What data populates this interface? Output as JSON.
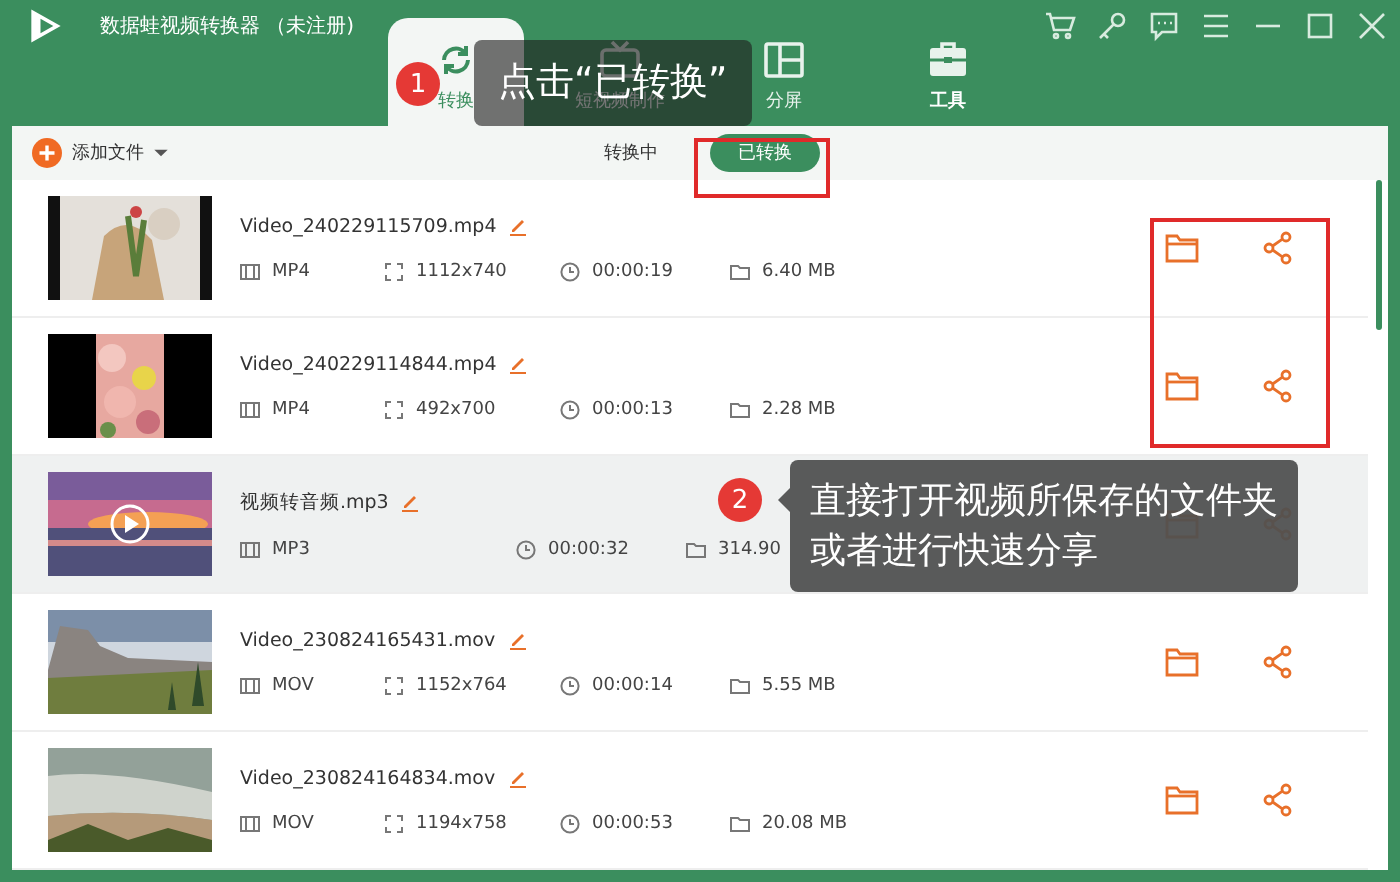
{
  "window": {
    "title": "数据蛙视频转换器 （未注册)"
  },
  "tabs": [
    {
      "label": "转换",
      "selected": true
    },
    {
      "label": "短视频制作",
      "selected": false
    },
    {
      "label": "分屏",
      "selected": false
    },
    {
      "label": "工具",
      "selected": false
    }
  ],
  "toolbar": {
    "add_label": "添加文件",
    "segments": [
      {
        "label": "转换中",
        "selected": false
      },
      {
        "label": "已转换",
        "selected": true
      }
    ]
  },
  "files": [
    {
      "name": "Video_240229115709.mp4",
      "format": "MP4",
      "resolution": "1112x740",
      "duration": "00:00:19",
      "size": "6.40 MB",
      "hovered": false,
      "preview": false
    },
    {
      "name": "Video_240229114844.mp4",
      "format": "MP4",
      "resolution": "492x700",
      "duration": "00:00:13",
      "size": "2.28 MB",
      "hovered": false,
      "preview": false
    },
    {
      "name": "视频转音频.mp3",
      "format": "MP3",
      "duration": "00:00:32",
      "size": "314.90",
      "hovered": true,
      "preview": true
    },
    {
      "name": "Video_230824165431.mov",
      "format": "MOV",
      "resolution": "1152x764",
      "duration": "00:00:14",
      "size": "5.55 MB",
      "hovered": false,
      "preview": false
    },
    {
      "name": "Video_230824164834.mov",
      "format": "MOV",
      "resolution": "1194x758",
      "duration": "00:00:53",
      "size": "20.08 MB",
      "hovered": false,
      "preview": false
    }
  ],
  "callouts": [
    {
      "number": "1",
      "text": "点击“已转换”"
    },
    {
      "number": "2",
      "lines": [
        "直接打开视频所保存的文件夹",
        "或者进行快速分享"
      ]
    }
  ]
}
